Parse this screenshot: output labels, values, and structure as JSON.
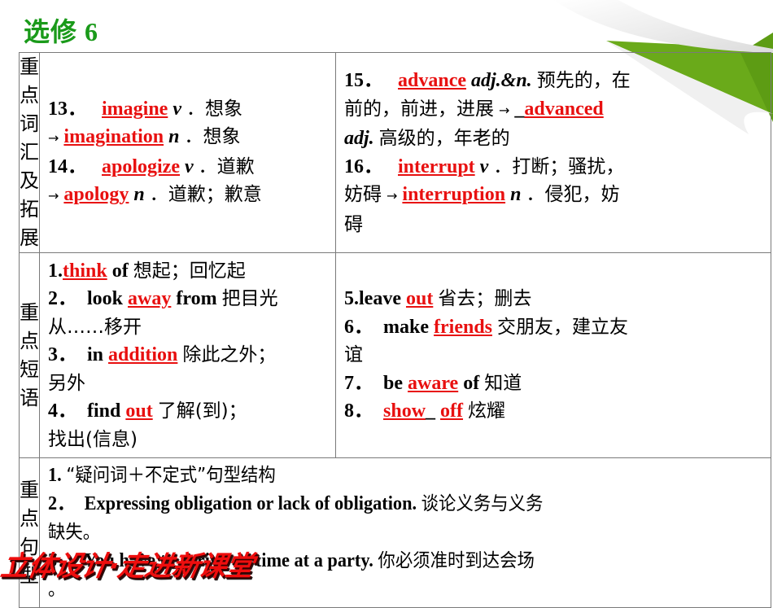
{
  "page_title": "选修 6",
  "footer_logo": "立体设计·走进新课堂",
  "colors": {
    "title_green": "#1a9a1a",
    "answer_red": "#e81010",
    "border": "#7a7a7a",
    "curl_green": "#6aaa1a"
  },
  "sections": {
    "vocab": {
      "label_lines": [
        "重点",
        "词汇",
        "及拓",
        "展"
      ],
      "left": {
        "l1_num": "13．",
        "l1_word": "imagine",
        "l1_pos": "v",
        "l1_def": "．想象",
        "l2_arrow": "→",
        "l2_word": "imagination",
        "l2_pos": "n",
        "l2_def": "．想象",
        "l3_num": "14．",
        "l3_word": "apologize",
        "l3_pos": "v",
        "l3_def": "．道歉",
        "l4_arrow": "→",
        "l4_word": "apology",
        "l4_pos": "n",
        "l4_def": "．道歉；歉意"
      },
      "right": {
        "l1_num": "15．",
        "l1_word": "advance",
        "l1_pos": "adj.&n.",
        "l1_def": "预先的，在",
        "l2_def": "前的，前进，进展",
        "l2_arrow": "→",
        "l2_blank": "_",
        "l2_word": "advanced",
        "l3_pos": "adj.",
        "l3_def": "高级的，年老的",
        "l4_num": "16．",
        "l4_word": "interrupt",
        "l4_pos": "v",
        "l4_def": "．打断；骚扰，",
        "l5_def": "妨碍",
        "l5_arrow": "→",
        "l5_word": "interruption",
        "l5_pos": "n",
        "l5_def2": "．侵犯，妨",
        "l6_def": "碍"
      }
    },
    "phrases": {
      "label_lines": [
        "重点",
        "短语"
      ],
      "left": {
        "p1_num": "1.",
        "p1_word": "think",
        "p1_rest": "of",
        "p1_def": "想起；回忆起",
        "p2_num": "2．",
        "p2_pre": "look",
        "p2_word": "away",
        "p2_rest": "from",
        "p2_def": "把目光",
        "p2_def2": "从……移开",
        "p3_num": "3．",
        "p3_pre": "in",
        "p3_word": "addition",
        "p3_def": "除此之外；",
        "p3_def2": "另外",
        "p4_num": "4．",
        "p4_pre": "find",
        "p4_word": "out",
        "p4_def": "了解(到)；",
        "p4_def2": "找出(信息)"
      },
      "right": {
        "p5_num": "5.",
        "p5_pre": "leave",
        "p5_word": "out",
        "p5_def": "省去；删去",
        "p6_num": "6．",
        "p6_pre": "make",
        "p6_word": "friends",
        "p6_def": "交朋友，建立友",
        "p6_def2": "谊",
        "p7_num": "7．",
        "p7_pre": "be",
        "p7_word": "aware",
        "p7_rest": "of",
        "p7_def": "知道",
        "p8_num": "8．",
        "p8_word": "show",
        "p8_blank": "_",
        "p8_word2": "off",
        "p8_def": "炫耀"
      }
    },
    "sentences": {
      "label_lines": [
        "重点",
        "句型"
      ],
      "s1_num": "1.",
      "s1_text": "“疑问词＋不定式”句型结构",
      "s2_num": "2．",
      "s2_en": "Expressing obligation or lack of obligation.",
      "s2_cn": "谈论义务与义务",
      "s2_cn2": "缺失。",
      "s3_num": "3．",
      "s3_en": "You have to arrive on time at a party.",
      "s3_cn": "你必须准时到达会场",
      "s3_cn2": "。"
    }
  }
}
